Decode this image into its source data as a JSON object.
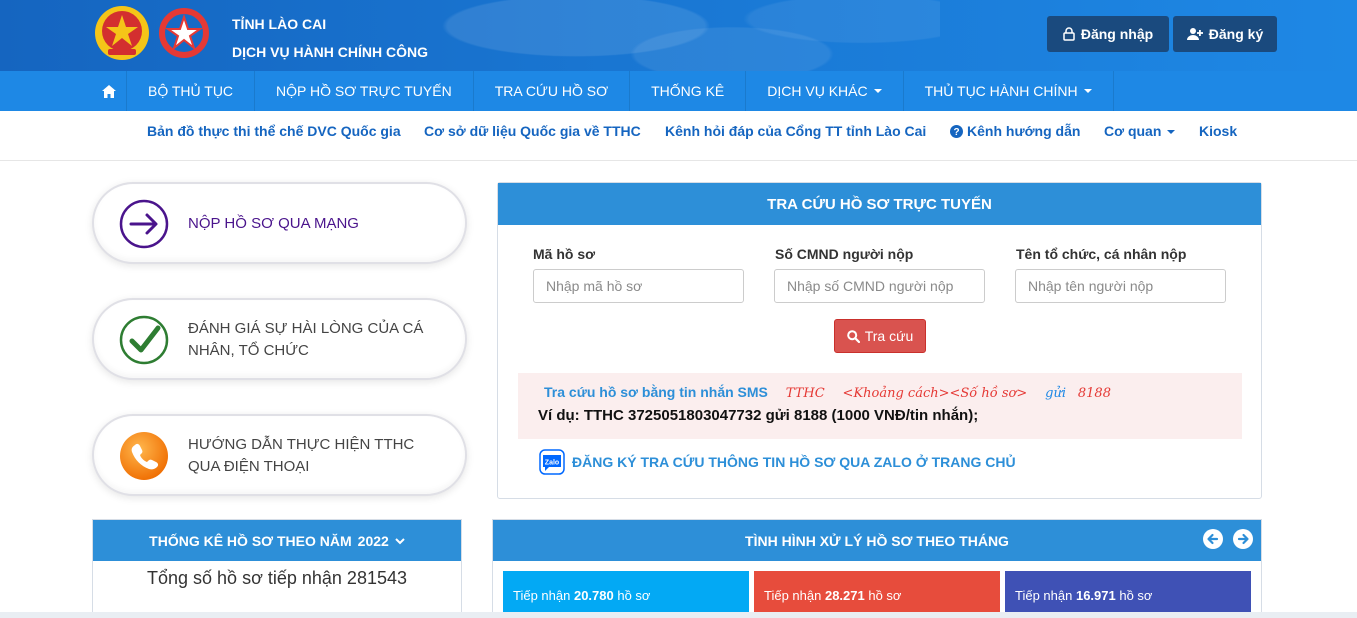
{
  "header": {
    "province": "TỈNH LÀO CAI",
    "service": "DỊCH VỤ HÀNH CHÍNH CÔNG",
    "login_label": "Đăng nhập",
    "register_label": "Đăng ký"
  },
  "main_nav": {
    "items": [
      {
        "label": "BỘ THỦ TỤC"
      },
      {
        "label": "NỘP HỒ SƠ TRỰC TUYẾN"
      },
      {
        "label": "TRA CỨU HỒ SƠ"
      },
      {
        "label": "THỐNG KÊ"
      },
      {
        "label": "DỊCH VỤ KHÁC"
      },
      {
        "label": "THỦ TỤC HÀNH CHÍNH"
      }
    ]
  },
  "sub_nav": {
    "items": [
      {
        "label": "Bản đồ thực thi thể chế DVC Quốc gia"
      },
      {
        "label": "Cơ sở dữ liệu Quốc gia về TTHC"
      },
      {
        "label": "Kênh hỏi đáp của Cổng TT tỉnh Lào Cai"
      },
      {
        "label": "Kênh hướng dẫn"
      },
      {
        "label": "Cơ quan"
      },
      {
        "label": "Kiosk"
      }
    ]
  },
  "actions": [
    {
      "label": "NỘP HỒ SƠ QUA MẠNG",
      "color": "#4a148c"
    },
    {
      "label": "ĐÁNH GIÁ SỰ HÀI LÒNG CỦA CÁ NHÂN, TỔ CHỨC",
      "color": "#444444"
    },
    {
      "label": "HƯỚNG DẪN THỰC HIỆN TTHC QUA ĐIỆN THOẠI",
      "color": "#444444"
    }
  ],
  "search": {
    "title": "TRA CỨU HỒ SƠ TRỰC TUYẾN",
    "fields": [
      {
        "label": "Mã hồ sơ",
        "placeholder": "Nhập mã hồ sơ"
      },
      {
        "label": "Số CMND người nộp",
        "placeholder": "Nhập số CMND người nộp"
      },
      {
        "label": "Tên tổ chức, cá nhân nộp",
        "placeholder": "Nhập tên người nộp"
      }
    ],
    "button_label": "Tra cứu",
    "sms_title": "Tra cứu hồ sơ bằng tin nhắn SMS",
    "sms_prefix": "TTHC",
    "sms_format": "<Khoảng cách><Số hồ sơ>",
    "sms_send": "gửi",
    "sms_number": "8188",
    "sms_example": "Ví dụ: TTHC 3725051803047732 gửi 8188 (1000 VNĐ/tin nhắn);",
    "zalo_label": "ĐĂNG KÝ TRA CỨU THÔNG TIN HỒ SƠ QUA ZALO Ở TRANG CHỦ"
  },
  "stats": {
    "title": "THỐNG KÊ HỒ SƠ THEO NĂM",
    "year": "2022",
    "total_text": "Tổng số hồ sơ tiếp nhận 281543"
  },
  "monthly": {
    "title": "TÌNH HÌNH XỬ LÝ HỒ SƠ THEO THÁNG",
    "cards": [
      {
        "prefix": "Tiếp nhận",
        "value": "20.780",
        "suffix": "hồ sơ",
        "color": "#03a9f4"
      },
      {
        "prefix": "Tiếp nhận",
        "value": "28.271",
        "suffix": "hồ sơ",
        "color": "#e74c3c"
      },
      {
        "prefix": "Tiếp nhận",
        "value": "16.971",
        "suffix": "hồ sơ",
        "color": "#3f51b5"
      }
    ]
  },
  "colors": {
    "header_blue": "#1976d2",
    "nav_blue": "#1e88e5",
    "panel_head_blue": "#2d8fd8",
    "search_red": "#d9534f"
  }
}
